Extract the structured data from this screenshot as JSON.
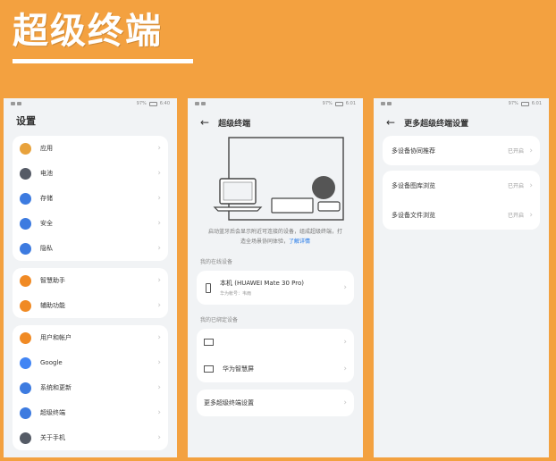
{
  "banner": {
    "title": "超级终端"
  },
  "statusbar": {
    "battery": "97%",
    "time": "6:40",
    "time2": "6:01"
  },
  "phone1": {
    "title": "设置",
    "group1": [
      {
        "label": "应用",
        "icon": "apps-icon",
        "color": "#e8a23c"
      },
      {
        "label": "电池",
        "icon": "battery-icon",
        "color": "#555b66"
      },
      {
        "label": "存储",
        "icon": "storage-icon",
        "color": "#3d7be0"
      },
      {
        "label": "安全",
        "icon": "shield-icon",
        "color": "#3d7be0"
      },
      {
        "label": "隐私",
        "icon": "privacy-icon",
        "color": "#3d7be0"
      }
    ],
    "group2": [
      {
        "label": "智慧助手",
        "icon": "assistant-icon",
        "color": "#f08a24"
      },
      {
        "label": "辅助功能",
        "icon": "accessibility-icon",
        "color": "#f08a24"
      }
    ],
    "group3": [
      {
        "label": "用户和帐户",
        "icon": "user-icon",
        "color": "#f08a24"
      },
      {
        "label": "Google",
        "icon": "google-icon",
        "color": "#4285f4"
      },
      {
        "label": "系统和更新",
        "icon": "system-update-icon",
        "color": "#3d7be0"
      },
      {
        "label": "超级终端",
        "icon": "super-device-icon",
        "color": "#3d7be0"
      },
      {
        "label": "关于手机",
        "icon": "about-icon",
        "color": "#555b66"
      }
    ]
  },
  "phone2": {
    "title": "超级终端",
    "note": "启动蓝牙后会显示附近可连接的设备，组成超级终端，打造全场景协同体验，",
    "note_link": "了解详情",
    "my_device_label": "我的在线设备",
    "my_device_name": "本机 (HUAWEI Mate 30 Pro)",
    "my_device_sub": "华为帐号：韦雨",
    "bound_label": "我的已绑定设备",
    "bound_devices": [
      {
        "name": "",
        "icon": "monitor-icon"
      },
      {
        "name": "华为智慧屏",
        "icon": "tv-icon"
      }
    ],
    "more_settings": "更多超级终端设置"
  },
  "phone3": {
    "title": "更多超级终端设置",
    "rows": [
      {
        "label": "多设备协同推荐",
        "value": "已开启"
      },
      {
        "label": "多设备图库浏览",
        "value": "已开启"
      },
      {
        "label": "多设备文件浏览",
        "value": "已开启"
      }
    ]
  }
}
